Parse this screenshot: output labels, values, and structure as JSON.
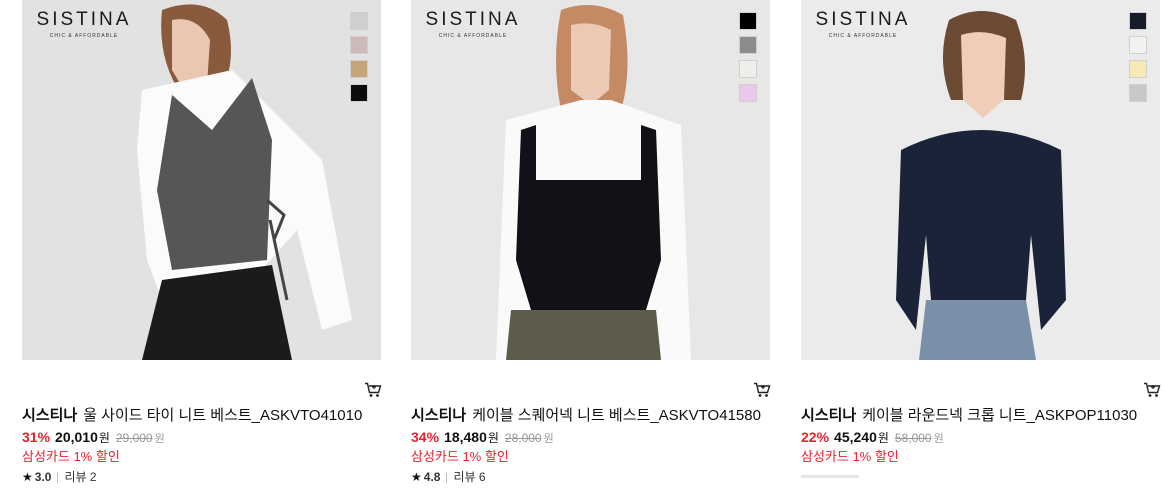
{
  "brand_logo": {
    "word": "SISTINA",
    "tagline": "CHIC & AFFORDABLE"
  },
  "products": [
    {
      "brand": "시스티나",
      "name": "울 사이드 타이 니트 베스트_ASKVTO41010",
      "discount": "31%",
      "price": "20,010",
      "currency": "원",
      "original_price": "29,000",
      "original_currency": "원",
      "promo": "삼성카드 1% 할인",
      "star": "★",
      "rating": "3.0",
      "reviews": "리뷰 2",
      "swatch_colors": [
        "#cfcfcf",
        "#cbbab5",
        "#c7a57a",
        "#0c0c0c"
      ],
      "image_bg": "#e3e3e3"
    },
    {
      "brand": "시스티나",
      "name": "케이블 스퀘어넥 니트 베스트_ASKVTO41580",
      "discount": "34%",
      "price": "18,480",
      "currency": "원",
      "original_price": "28,000",
      "original_currency": "원",
      "promo": "삼성카드 1% 할인",
      "star": "★",
      "rating": "4.8",
      "reviews": "리뷰 6",
      "swatch_colors": [
        "#000000",
        "#8c8c8c",
        "#efefea",
        "#eac8ea"
      ],
      "image_bg": "#e8e8e8"
    },
    {
      "brand": "시스티나",
      "name": "케이블 라운드넥 크롭 니트_ASKPOP11030",
      "discount": "22%",
      "price": "45,240",
      "currency": "원",
      "original_price": "58,000",
      "original_currency": "원",
      "promo": "삼성카드 1% 할인",
      "star": "",
      "rating": "",
      "reviews": "",
      "swatch_colors": [
        "#161c2a",
        "#f3f2ee",
        "#f5e9b4",
        "#c8c8c8"
      ],
      "image_bg": "#ececec"
    }
  ],
  "colors": {
    "accent": "#e8222d",
    "text": "#111111",
    "muted": "#999999"
  },
  "icons": {
    "cart": "shopping-cart-icon",
    "star": "star-icon"
  }
}
